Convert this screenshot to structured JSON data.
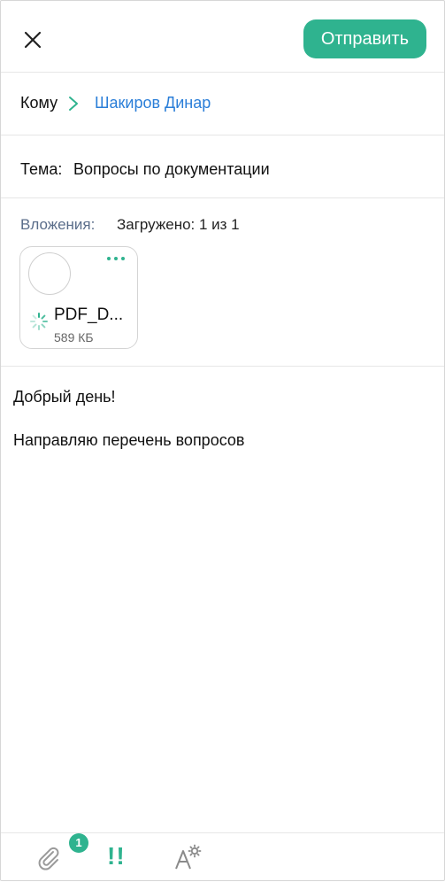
{
  "header": {
    "send_label": "Отправить",
    "close_icon": "close-icon",
    "accent_color": "#2fb38f"
  },
  "recipient": {
    "label": "Кому",
    "value": "Шакиров Динар",
    "chevron_icon": "chevron-right-icon",
    "link_color": "#2a7ed8"
  },
  "subject": {
    "label": "Тема:",
    "value": "Вопросы по документации"
  },
  "attachments": {
    "label": "Вложения:",
    "status": "Загружено: 1 из 1",
    "items": [
      {
        "name": "PDF_D...",
        "size": "589 КБ",
        "menu_icon": "more-dots-icon",
        "loading_icon": "spinner-icon"
      }
    ]
  },
  "message": {
    "line1": "Добрый день!",
    "line2": "Направляю перечень вопросов"
  },
  "toolbar": {
    "attach_icon": "paperclip-icon",
    "attach_count": "1",
    "priority_label": "!!",
    "format_icon": "text-format-icon"
  }
}
